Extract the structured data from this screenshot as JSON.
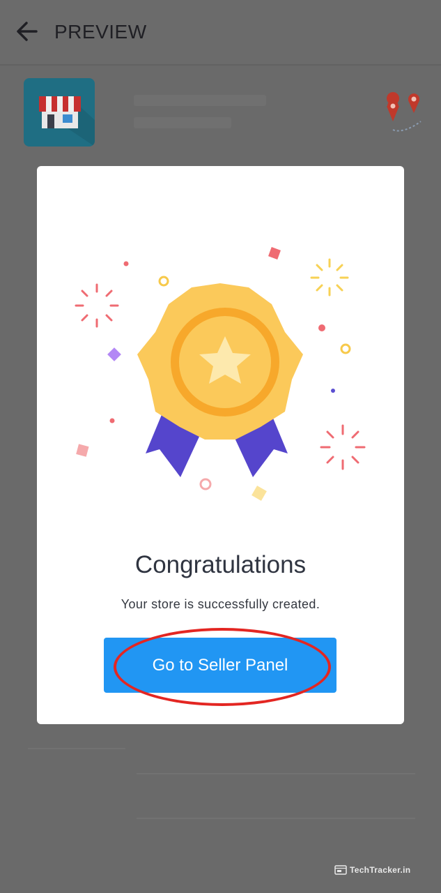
{
  "appbar": {
    "title": "PREVIEW",
    "back_icon": "arrow-left-icon"
  },
  "background": {
    "store_icon": "storefront-icon",
    "location_icon": "map-pins-icon"
  },
  "modal": {
    "illustration": "award-ribbon-star-icon",
    "title": "Congratulations",
    "message": "Your store is successfully created.",
    "button_label": "Go to Seller Panel",
    "button_color": "#2196f3",
    "highlight_color": "#e32622"
  },
  "watermark": {
    "text": "TechTracker.in"
  }
}
